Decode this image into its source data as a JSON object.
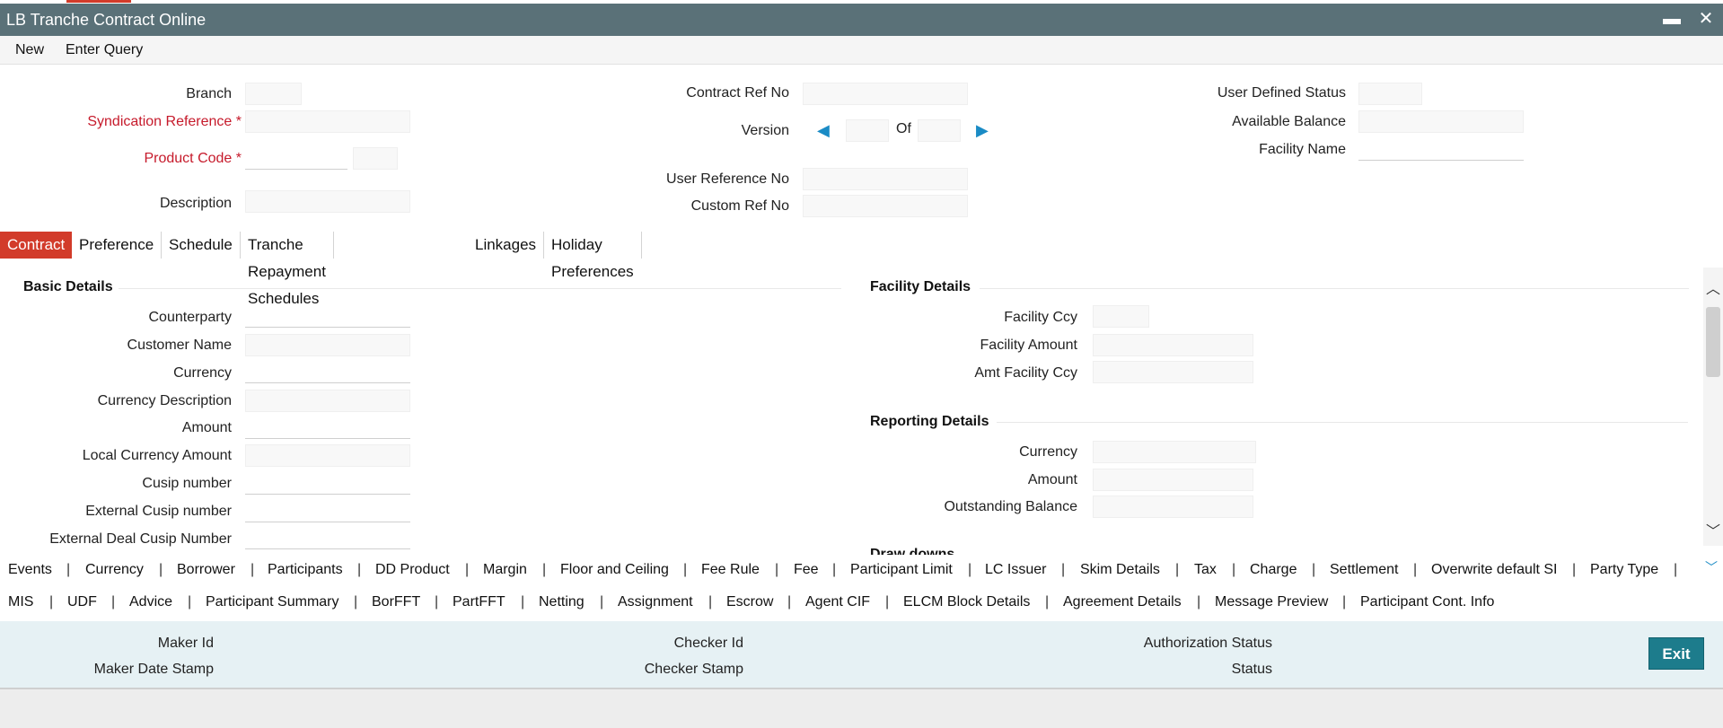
{
  "window": {
    "title": "LB Tranche Contract Online",
    "minimize": "▬",
    "close": "✕"
  },
  "menu": {
    "new": "New",
    "enter_query": "Enter Query"
  },
  "header": {
    "branch": "Branch",
    "syndication_reference": "Syndication Reference *",
    "product_code": "Product Code *",
    "description": "Description",
    "contract_ref_no": "Contract Ref No",
    "version": "Version",
    "version_of": "Of",
    "user_reference_no": "User Reference No",
    "custom_ref_no": "Custom Ref No",
    "user_defined_status": "User Defined Status",
    "available_balance": "Available Balance",
    "facility_name": "Facility Name"
  },
  "tabs": [
    "Contract",
    "Preference",
    "Schedule",
    "Tranche Repayment Schedules",
    "Linkages",
    "Holiday Preferences"
  ],
  "basic_details": {
    "title": "Basic Details",
    "counterparty": "Counterparty",
    "customer_name": "Customer Name",
    "currency": "Currency",
    "currency_description": "Currency Description",
    "amount": "Amount",
    "local_currency_amount": "Local Currency Amount",
    "cusip_number": "Cusip number",
    "external_cusip_number": "External Cusip number",
    "external_deal_cusip_number": "External Deal Cusip Number"
  },
  "facility_details": {
    "title": "Facility Details",
    "facility_ccy": "Facility Ccy",
    "facility_amount": "Facility Amount",
    "amt_facility_ccy": "Amt Facility Ccy"
  },
  "reporting_details": {
    "title": "Reporting Details",
    "currency": "Currency",
    "amount": "Amount",
    "outstanding_balance": "Outstanding Balance"
  },
  "cut_section": "Draw downs",
  "links_row1": [
    "Events",
    "Currency",
    "Borrower",
    "Participants",
    "DD Product",
    "Margin",
    "Floor and Ceiling",
    "Fee Rule",
    "Fee",
    "Participant Limit",
    "LC Issuer",
    "Skim Details",
    "Tax",
    "Charge",
    "Settlement",
    "Overwrite default SI",
    "Party Type"
  ],
  "links_row2": [
    "MIS",
    "UDF",
    "Advice",
    "Participant Summary",
    "BorFFT",
    "PartFFT",
    "Netting",
    "Assignment",
    "Escrow",
    "Agent CIF",
    "ELCM Block Details",
    "Agreement Details",
    "Message Preview",
    "Participant Cont. Info"
  ],
  "footer": {
    "maker_id": "Maker Id",
    "maker_date_stamp": "Maker Date Stamp",
    "checker_id": "Checker Id",
    "checker_stamp": "Checker Stamp",
    "authorization_status": "Authorization Status",
    "status": "Status",
    "exit": "Exit"
  },
  "icons": {
    "prev": "◀",
    "next": "▶",
    "scroll_up": "︿",
    "scroll_down": "﹀",
    "links_expand": "﹀"
  }
}
